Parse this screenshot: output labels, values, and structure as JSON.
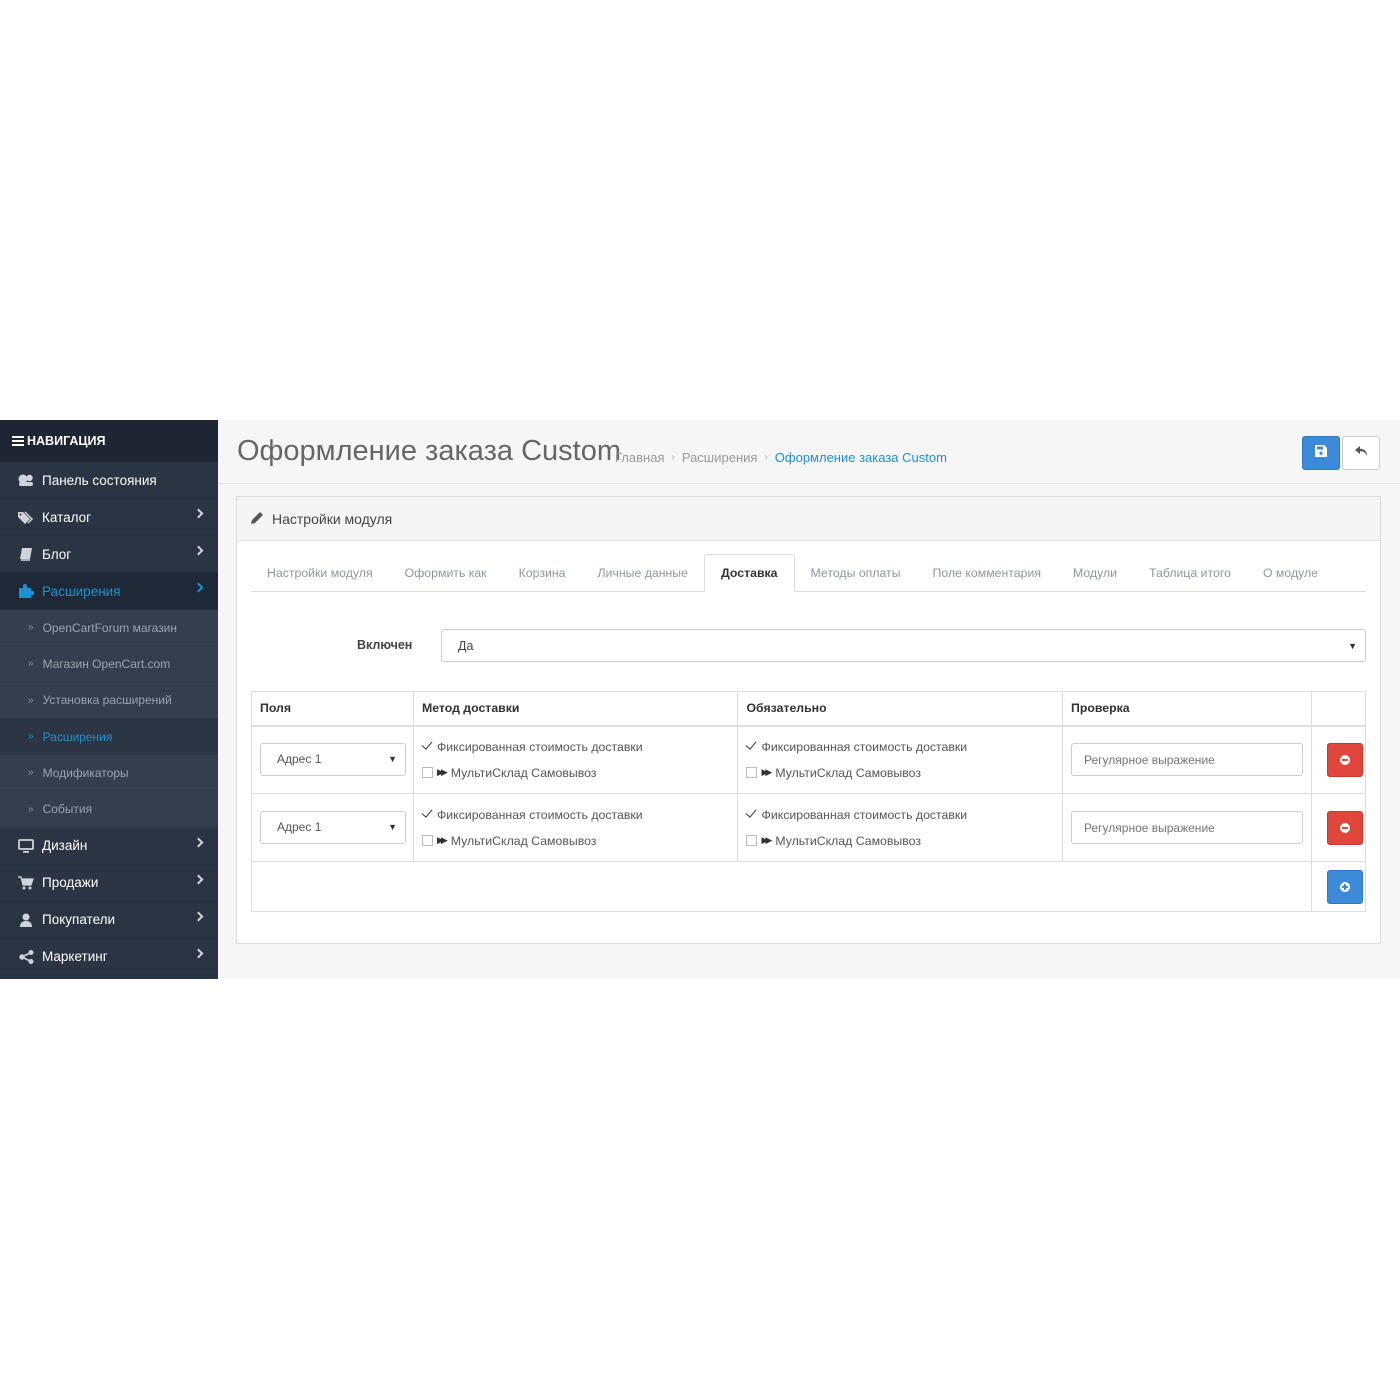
{
  "nav": {
    "heading": "НАВИГАЦИЯ",
    "items": [
      {
        "label": "Панель состояния",
        "icon": "dashboard-icon"
      },
      {
        "label": "Каталог",
        "icon": "tags-icon"
      },
      {
        "label": "Блог",
        "icon": "book-icon"
      },
      {
        "label": "Расширения",
        "icon": "puzzle-icon"
      },
      {
        "label": "Дизайн",
        "icon": "monitor-icon"
      },
      {
        "label": "Продажи",
        "icon": "cart-icon"
      },
      {
        "label": "Покупатели",
        "icon": "user-icon"
      },
      {
        "label": "Маркетинг",
        "icon": "share-icon"
      }
    ],
    "sub_items": [
      {
        "label": "OpenCartForum магазин"
      },
      {
        "label": "Магазин OpenCart.com"
      },
      {
        "label": "Установка расширений"
      },
      {
        "label": "Расширения"
      },
      {
        "label": "Модификаторы"
      },
      {
        "label": "События"
      }
    ]
  },
  "header": {
    "title": "Оформление заказа Custom",
    "breadcrumb": [
      "Главная",
      "Расширения",
      "Оформление заказа Custom"
    ]
  },
  "panel": {
    "title": "Настройки модуля",
    "tabs": [
      "Настройки модуля",
      "Оформить как",
      "Корзина",
      "Личные данные",
      "Доставка",
      "Методы оплаты",
      "Поле комментария",
      "Модули",
      "Таблица итого",
      "О модуле"
    ],
    "active_tab": "Доставка",
    "enabled_label": "Включен",
    "enabled_value": "Да",
    "table": {
      "headers": [
        "Поля",
        "Метод доставки",
        "Обязательно",
        "Проверка"
      ],
      "rows": [
        {
          "field": "Адрес 1",
          "methods": [
            {
              "label": "Фиксированная стоимость доставки",
              "checked": true
            },
            {
              "label": "МультиСклад Самовывоз",
              "checked": false
            }
          ],
          "required": [
            {
              "label": "Фиксированная стоимость доставки",
              "checked": true
            },
            {
              "label": "МультиСклад Самовывоз",
              "checked": false
            }
          ],
          "regex_placeholder": "Регулярное выражение"
        },
        {
          "field": "Адрес 1",
          "methods": [
            {
              "label": "Фиксированная стоимость доставки",
              "checked": true
            },
            {
              "label": "МультиСклад Самовывоз",
              "checked": false
            }
          ],
          "required": [
            {
              "label": "Фиксированная стоимость доставки",
              "checked": true
            },
            {
              "label": "МультиСклад Самовывоз",
              "checked": false
            }
          ],
          "regex_placeholder": "Регулярное выражение"
        }
      ]
    }
  },
  "colors": {
    "sidebar_bg": "#2b3443",
    "accent": "#1e91cf",
    "primary_button": "#3c8ad8",
    "danger_button": "#e0463b"
  }
}
